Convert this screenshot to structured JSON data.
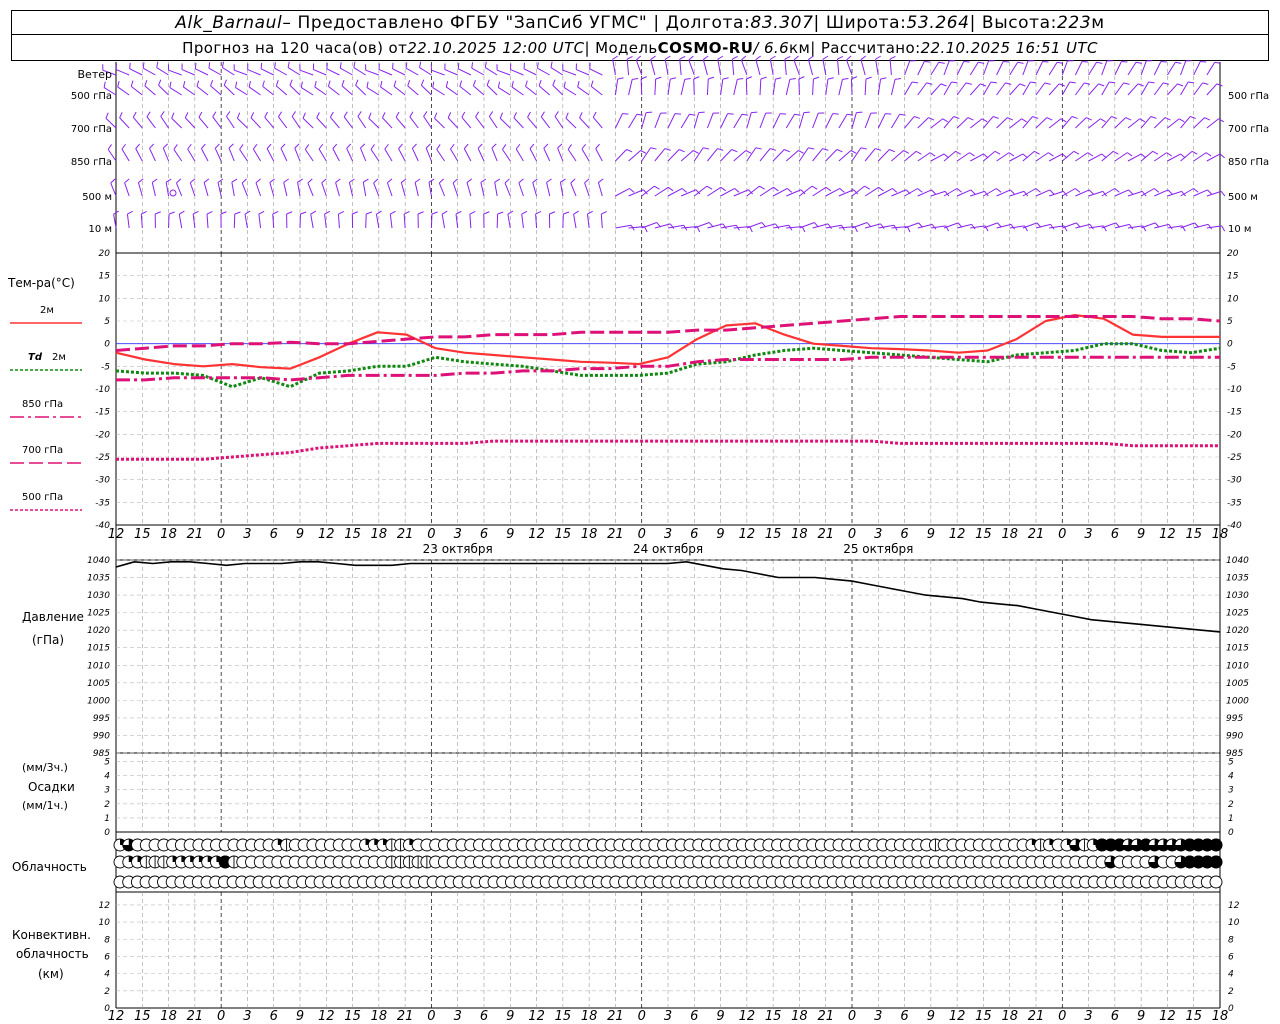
{
  "header": {
    "station": "Alk_Barnaul",
    "provider": " – Предоставлено ФГБУ \"ЗапСиб УГМС\" | Долгота: ",
    "lon": "83.307",
    "lat_label": " | Широта: ",
    "lat": "53.264",
    "alt_label": " | Высота: ",
    "alt": "223",
    "alt_unit": "м",
    "forecast_label": "Прогноз на 120 часа(ов)  от ",
    "forecast_start": "22.10.2025 12:00 UTC",
    "model_label": "  | Модель ",
    "model": "COSMO-RU",
    "res": " / 6.6",
    "res_unit": "км",
    "calc_label": " | Рассчитано: ",
    "calc_time": "22.10.2025 16:51 UTC"
  },
  "labels": {
    "wind": "Ветер",
    "temp": "Тем-ра(°C)",
    "t2m": "2м",
    "td": "Td",
    "td2m": "2м",
    "t850": "850 гПа",
    "t700": "700 гПа",
    "t500": "500 гПа",
    "pressure": "Давление",
    "pressure_unit": "(гПа)",
    "precip_unit3": "(мм/3ч.)",
    "precip": "Осадки",
    "precip_unit1": "(мм/1ч.)",
    "cloud": "Облачность",
    "conv1": "Конвективн.",
    "conv2": "облачность",
    "conv3": "(км)"
  },
  "colors": {
    "t2m": "#ff3333",
    "td2m": "#118811",
    "t850": "#dd1177",
    "t700": "#dd1177",
    "t500": "#dd1177",
    "wind": "#8822ee",
    "pressure": "#000000",
    "zero_line": "#3333ff"
  },
  "chart_data": [
    {
      "type": "line",
      "id": "temperature",
      "ylim": [
        -40,
        20
      ],
      "yticks": [
        20,
        15,
        10,
        5,
        0,
        -5,
        -10,
        -15,
        -20,
        -25,
        -30,
        -35,
        -40
      ],
      "x_hours": [
        0,
        3,
        6,
        9,
        12,
        15,
        18,
        21,
        24,
        27,
        30,
        33,
        36,
        39,
        42,
        45,
        48,
        51,
        54,
        57,
        60,
        63,
        66,
        69,
        72,
        75,
        78,
        81,
        84,
        87,
        90,
        93,
        96,
        99,
        102,
        105,
        108,
        111,
        114,
        117,
        120,
        123,
        126
      ],
      "xtick_labels": [
        "12",
        "15",
        "18",
        "21",
        "0",
        "3",
        "6",
        "9",
        "12",
        "15",
        "18",
        "21",
        "0",
        "3",
        "6",
        "9",
        "12",
        "15",
        "18",
        "21",
        "0",
        "3",
        "6",
        "9",
        "12",
        "15",
        "18",
        "21",
        "0",
        "3",
        "6",
        "9",
        "12",
        "15",
        "18",
        "21",
        "0",
        "3",
        "6",
        "9",
        "12",
        "15",
        "18"
      ],
      "day_labels": [
        {
          "hour": 33,
          "text": "23 октября"
        },
        {
          "hour": 57,
          "text": "24 октября"
        },
        {
          "hour": 81,
          "text": "25 октября"
        }
      ],
      "series": [
        {
          "name": "2м",
          "key": "t2m",
          "values": [
            -2,
            -3.5,
            -4.5,
            -5,
            -4.5,
            -5.2,
            -5.5,
            -3,
            0,
            2.5,
            2,
            -1,
            -2,
            -2.5,
            -3,
            -3.5,
            -4,
            -4.2,
            -4.5,
            -3,
            1,
            4,
            4.5,
            2,
            0,
            -0.5,
            -1,
            -1.2,
            -1.5,
            -2,
            -1.5,
            1,
            5,
            6.3,
            5.5,
            2,
            1.5,
            1.5,
            1.5
          ]
        },
        {
          "name": "Td 2м",
          "key": "td2m",
          "values": [
            -6,
            -6.5,
            -6.5,
            -7,
            -9.5,
            -7.5,
            -9.5,
            -6.5,
            -6,
            -5,
            -5,
            -3,
            -4,
            -4.5,
            -5,
            -6,
            -7,
            -7,
            -7,
            -6.5,
            -4.5,
            -4,
            -2.5,
            -1.5,
            -1,
            -1.5,
            -2,
            -2.5,
            -3,
            -3.5,
            -4,
            -2.5,
            -2,
            -1.5,
            0,
            0,
            -1.5,
            -2,
            -1
          ]
        },
        {
          "name": "850 гПа",
          "key": "t850",
          "values": [
            -8,
            -8,
            -7.5,
            -7.5,
            -7.5,
            -7.5,
            -8,
            -7.5,
            -7,
            -7,
            -7,
            -7,
            -6.5,
            -6.5,
            -6,
            -6,
            -5.5,
            -5.5,
            -5,
            -5,
            -4,
            -3.5,
            -3.5,
            -3.5,
            -3.5,
            -3.5,
            -3,
            -3,
            -3,
            -3,
            -3,
            -3,
            -3,
            -3,
            -3,
            -3,
            -3,
            -3,
            -3
          ]
        },
        {
          "name": "700 гПа",
          "key": "t700",
          "values": [
            -1.5,
            -1,
            -0.5,
            -0.5,
            0,
            0,
            0.3,
            0,
            0,
            0.5,
            1,
            1.5,
            1.5,
            2,
            2,
            2,
            2.5,
            2.5,
            2.5,
            2.5,
            3,
            3,
            3.5,
            4,
            4.5,
            5,
            5.5,
            6,
            6,
            6,
            6,
            6,
            6,
            6,
            6,
            6,
            5.5,
            5.5,
            5
          ]
        },
        {
          "name": "500 гПа",
          "key": "t500",
          "values": [
            -25.5,
            -25.5,
            -25.5,
            -25.5,
            -25,
            -24.5,
            -24,
            -23,
            -22.5,
            -22,
            -22,
            -22,
            -22,
            -21.5,
            -21.5,
            -21.5,
            -21.5,
            -21.5,
            -21.5,
            -21.5,
            -21.5,
            -21.5,
            -21.5,
            -21.5,
            -21.5,
            -21.5,
            -21.5,
            -22,
            -22,
            -22,
            -22,
            -22,
            -22,
            -22,
            -22,
            -22.5,
            -22.5,
            -22.5,
            -22.5
          ]
        }
      ]
    },
    {
      "type": "line",
      "id": "pressure",
      "ylim": [
        985,
        1040
      ],
      "yticks": [
        1040,
        1035,
        1030,
        1025,
        1020,
        1015,
        1010,
        1005,
        1000,
        995,
        990,
        985
      ],
      "series": [
        {
          "name": "Давление",
          "key": "pressure",
          "values": [
            1038,
            1039.5,
            1039,
            1039.5,
            1039.5,
            1039,
            1038.5,
            1039,
            1039,
            1039,
            1039.5,
            1039.5,
            1039,
            1038.5,
            1038.5,
            1038.5,
            1039,
            1039,
            1039,
            1039,
            1039,
            1039,
            1039,
            1039,
            1039,
            1039,
            1039,
            1039,
            1039,
            1039,
            1039,
            1039.5,
            1038.5,
            1037.5,
            1037,
            1036,
            1035,
            1035,
            1035,
            1034.5,
            1034,
            1033,
            1032,
            1031,
            1030,
            1029.5,
            1029,
            1028,
            1027.5,
            1027,
            1026,
            1025,
            1024,
            1023,
            1022.5,
            1022,
            1021.5,
            1021,
            1020.5,
            1020,
            1019.5
          ]
        }
      ]
    },
    {
      "type": "bar",
      "id": "precipitation",
      "ylim": [
        0,
        5
      ],
      "yticks": [
        5,
        4,
        3,
        2,
        1,
        0
      ],
      "values": []
    },
    {
      "type": "table",
      "id": "cloudiness",
      "rows": [
        [
          2,
          3,
          0,
          0,
          0,
          0,
          0,
          0,
          0,
          0,
          0,
          0,
          0,
          0,
          0,
          0,
          0,
          0,
          2,
          1,
          0,
          0,
          0,
          0,
          0,
          0,
          0,
          0,
          2,
          2,
          2,
          1,
          1,
          2,
          0,
          0,
          0,
          0,
          0,
          0,
          0,
          0,
          0,
          0,
          0,
          0,
          0,
          0,
          0,
          0,
          0,
          0,
          0,
          0,
          0,
          0,
          0,
          0,
          0,
          0,
          0,
          0,
          0,
          0,
          0,
          0,
          0,
          0,
          0,
          0,
          0,
          0,
          0,
          0,
          0,
          0,
          0,
          0,
          0,
          0,
          0,
          0,
          0,
          0,
          0,
          0,
          0,
          0,
          0,
          0,
          0,
          0,
          0,
          1,
          0,
          0,
          0,
          0,
          0,
          0,
          0,
          0,
          0,
          0,
          2,
          1,
          2,
          0,
          2,
          3,
          1,
          2,
          4,
          4,
          4,
          3,
          3,
          4,
          3,
          3,
          3,
          3,
          4,
          4,
          4,
          4
        ],
        [
          0,
          2,
          2,
          1,
          1,
          1,
          2,
          2,
          2,
          2,
          2,
          2,
          4,
          1,
          0,
          0,
          0,
          0,
          0,
          0,
          0,
          0,
          0,
          0,
          0,
          0,
          0,
          0,
          0,
          0,
          0,
          1,
          1,
          1,
          1,
          1,
          0,
          0,
          0,
          0,
          0,
          0,
          0,
          0,
          0,
          0,
          0,
          0,
          0,
          0,
          0,
          0,
          0,
          0,
          0,
          0,
          0,
          0,
          0,
          0,
          0,
          0,
          0,
          0,
          0,
          0,
          0,
          0,
          0,
          0,
          0,
          0,
          0,
          0,
          0,
          0,
          0,
          0,
          0,
          0,
          0,
          0,
          0,
          0,
          0,
          0,
          0,
          0,
          0,
          0,
          0,
          0,
          0,
          0,
          0,
          0,
          0,
          0,
          0,
          0,
          0,
          0,
          0,
          0,
          0,
          0,
          0,
          0,
          0,
          0,
          0,
          0,
          0,
          3,
          0,
          0,
          0,
          0,
          3,
          0,
          0,
          3,
          4,
          4,
          4,
          4
        ],
        [
          0,
          0,
          0,
          0,
          0,
          0,
          0,
          0,
          0,
          0,
          0,
          0,
          0,
          0,
          0,
          0,
          0,
          0,
          0,
          0,
          0,
          0,
          0,
          0,
          0,
          0,
          0,
          0,
          0,
          0,
          0,
          0,
          0,
          0,
          0,
          0,
          0,
          0,
          0,
          0,
          0,
          0,
          0,
          0,
          0,
          0,
          0,
          0,
          0,
          0,
          0,
          0,
          0,
          0,
          0,
          0,
          0,
          0,
          0,
          0,
          0,
          0,
          0,
          0,
          0,
          0,
          0,
          0,
          0,
          0,
          0,
          0,
          0,
          0,
          0,
          0,
          0,
          0,
          0,
          0,
          0,
          0,
          0,
          0,
          0,
          0,
          0,
          0,
          0,
          0,
          0,
          0,
          0,
          0,
          0,
          0,
          0,
          0,
          0,
          0,
          0,
          0,
          0,
          0,
          0,
          0,
          0,
          0,
          0,
          0,
          0,
          0,
          0,
          0,
          0,
          0,
          0,
          0,
          0,
          0,
          0,
          0,
          0,
          0,
          0,
          0,
          0
        ]
      ]
    },
    {
      "type": "bar",
      "id": "convective",
      "ylim": [
        0,
        13
      ],
      "yticks": [
        12,
        10,
        8,
        6,
        4,
        2,
        0
      ],
      "values": []
    }
  ],
  "wind": {
    "levels": [
      "500 гПа",
      "700 гПа",
      "850 гПа",
      "500 м",
      "10  м"
    ],
    "right_levels": [
      "500 гПа",
      "700 гПа",
      "850 гПа",
      "500 м",
      "10  м"
    ]
  }
}
